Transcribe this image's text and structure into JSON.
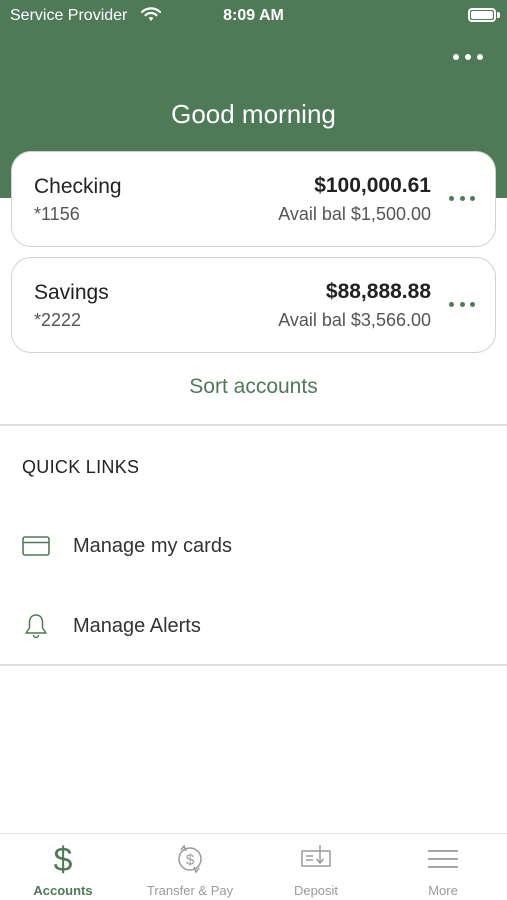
{
  "status_bar": {
    "carrier": "Service Provider",
    "time": "8:09 AM",
    "wifi_icon": "wifi-icon",
    "battery_icon": "battery-icon"
  },
  "header": {
    "greeting": "Good morning",
    "menu_icon": "more-horizontal-icon",
    "background_color": "#4f7a57"
  },
  "accounts": [
    {
      "name": "Checking",
      "number": "*1156",
      "balance": "$100,000.61",
      "available": "Avail bal $1,500.00",
      "more_icon": "more-horizontal-icon"
    },
    {
      "name": "Savings",
      "number": "*2222",
      "balance": "$88,888.88",
      "available": "Avail bal $3,566.00",
      "more_icon": "more-horizontal-icon"
    }
  ],
  "sort_accounts_label": "Sort accounts",
  "quick_links": {
    "title": "QUICK LINKS",
    "items": [
      {
        "label": "Manage my cards",
        "icon": "credit-card-icon"
      },
      {
        "label": "Manage Alerts",
        "icon": "bell-icon"
      }
    ]
  },
  "tabbar": {
    "active_color": "#4f7a57",
    "inactive_color": "#9a9a9a",
    "tabs": [
      {
        "label": "Accounts",
        "icon": "dollar-icon",
        "active": true
      },
      {
        "label": "Transfer & Pay",
        "icon": "transfer-dollar-icon",
        "active": false
      },
      {
        "label": "Deposit",
        "icon": "check-deposit-icon",
        "active": false
      },
      {
        "label": "More",
        "icon": "menu-icon",
        "active": false
      }
    ]
  }
}
